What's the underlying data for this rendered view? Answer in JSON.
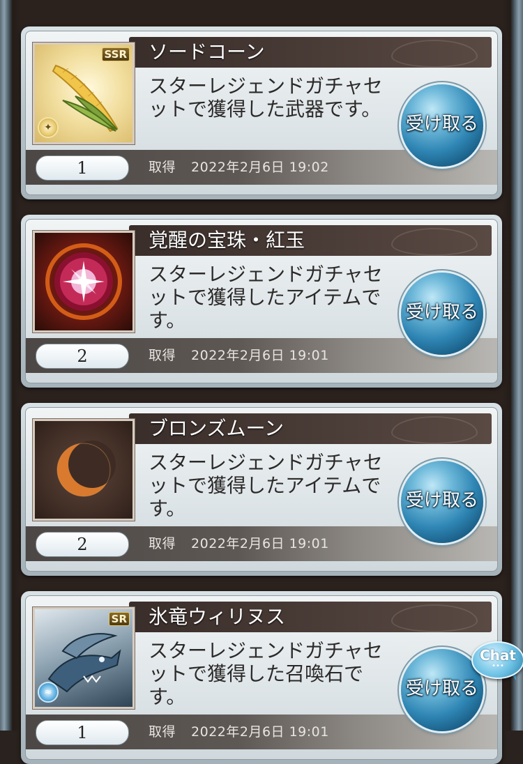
{
  "colors": {
    "title_bar": "#3a2e2a",
    "receive_button": "#2f86b4",
    "card_bg": "#e6ecee"
  },
  "items": [
    {
      "name": "ソードコーン",
      "description": "スターレジェンドガチャセットで獲得した武器です。",
      "quantity": "1",
      "obtained_label": "取得",
      "obtained_date": "2022年2月6日 19:02",
      "button_label": "受け取る",
      "icon": "corn-icon",
      "rarity": "SSR",
      "element": "light"
    },
    {
      "name": "覚醒の宝珠・紅玉",
      "description": "スターレジェンドガチャセットで獲得したアイテムです。",
      "quantity": "2",
      "obtained_label": "取得",
      "obtained_date": "2022年2月6日 19:01",
      "button_label": "受け取る",
      "icon": "red-orb-icon"
    },
    {
      "name": "ブロンズムーン",
      "description": "スターレジェンドガチャセットで獲得したアイテムです。",
      "quantity": "2",
      "obtained_label": "取得",
      "obtained_date": "2022年2月6日 19:01",
      "button_label": "受け取る",
      "icon": "crescent-moon-icon"
    },
    {
      "name": "氷竜ウィリヌス",
      "description": "スターレジェンドガチャセットで獲得した召喚石です。",
      "quantity": "1",
      "obtained_label": "取得",
      "obtained_date": "2022年2月6日 19:01",
      "button_label": "受け取る",
      "icon": "ice-dragon-icon",
      "rarity": "SR",
      "element": "water"
    }
  ],
  "chat": {
    "label": "Chat",
    "dots": "•••"
  }
}
